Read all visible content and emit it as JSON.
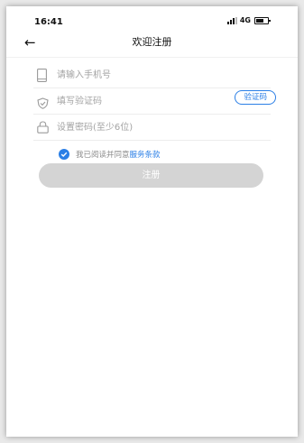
{
  "status_bar": {
    "time": "16:41",
    "network": "4G"
  },
  "nav": {
    "title": "欢迎注册",
    "back_icon": "arrow-left-icon"
  },
  "form": {
    "phone": {
      "placeholder": "请输入手机号",
      "value": "",
      "icon": "phone-icon"
    },
    "code": {
      "placeholder": "填写验证码",
      "value": "",
      "icon": "shield-icon",
      "button_label": "验证码"
    },
    "password": {
      "placeholder": "设置密码(至少6位)",
      "value": "",
      "icon": "lock-icon"
    },
    "agreement": {
      "checked": true,
      "text": "我已阅读并同意",
      "link": "服务条款"
    },
    "submit_label": "注册"
  },
  "colors": {
    "accent": "#2b7fe6",
    "button_disabled": "#d4d4d4",
    "placeholder": "#a3a3a3"
  }
}
